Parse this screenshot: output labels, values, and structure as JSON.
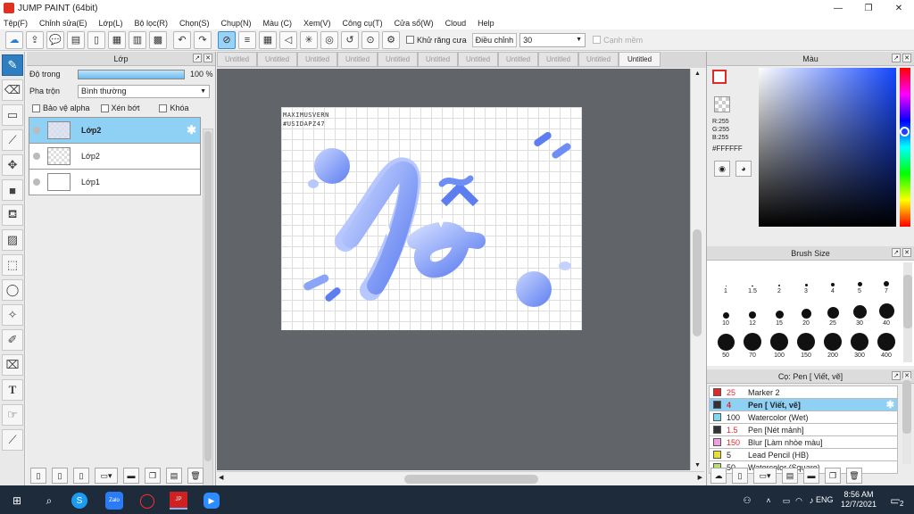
{
  "window": {
    "title": "JUMP PAINT (64bit)"
  },
  "menu": [
    "Tệp(F)",
    "Chỉnh sửa(E)",
    "Lớp(L)",
    "Bộ lọc(R)",
    "Chọn(S)",
    "Chụp(N)",
    "Màu (C)",
    "Xem(V)",
    "Công cụ(T)",
    "Cửa sổ(W)",
    "Cloud",
    "Help"
  ],
  "toolbar": {
    "antialias_label": "Khử răng cưa",
    "adjust_label": "Điều chỉnh",
    "adjust_value": "30",
    "snap_label": "Cạnh mềm"
  },
  "layer_panel": {
    "title": "Lớp",
    "opacity_label": "Độ trong",
    "opacity_value": "100 %",
    "opacity_fraction": 1.0,
    "blend_label": "Pha trộn",
    "blend_value": "Bình thường",
    "protect_alpha": "Bảo vệ alpha",
    "clip": "Xén bớt",
    "lock": "Khóa",
    "layers": [
      {
        "name": "Lớp2",
        "selected": true
      },
      {
        "name": "Lớp2",
        "selected": false
      },
      {
        "name": "Lớp1",
        "selected": false
      }
    ]
  },
  "tabs": [
    "Untitled",
    "Untitled",
    "Untitled",
    "Untitled",
    "Untitled",
    "Untitled",
    "Untitled",
    "Untitled",
    "Untitled",
    "Untitled",
    "Untitled"
  ],
  "artwork": {
    "signature_line1": "MAXIMUSVERN",
    "signature_line2": "#USIDAPZ47",
    "word": "Vẽ",
    "accent": "#6e8ef5"
  },
  "color_panel": {
    "title": "Màu",
    "r": "R:255",
    "g": "G:255",
    "b": "B:255",
    "hex": "#FFFFFF"
  },
  "brush_size": {
    "title": "Brush Size",
    "sizes": [
      "1",
      "1.5",
      "2",
      "3",
      "4",
      "5",
      "7",
      "10",
      "12",
      "15",
      "20",
      "25",
      "30",
      "40",
      "50",
      "70",
      "100",
      "150",
      "200",
      "300",
      "400"
    ]
  },
  "brush_list": {
    "title": "Cọ: Pen [ Viết, vẽ]",
    "items": [
      {
        "size": "25",
        "name": "Marker 2",
        "color": "#e02a2a",
        "selected": false,
        "size_color": "#e02a2a"
      },
      {
        "size": "4",
        "name": "Pen [ Viết, vẽ]",
        "color": "#333333",
        "selected": true,
        "size_color": "#e02a2a"
      },
      {
        "size": "100",
        "name": "Watercolor (Wet)",
        "color": "#7fd8f0",
        "selected": false,
        "size_color": "#222222"
      },
      {
        "size": "1.5",
        "name": "Pen [Nét mảnh]",
        "color": "#333333",
        "selected": false,
        "size_color": "#e02a2a"
      },
      {
        "size": "150",
        "name": "Blur [Làm nhòe màu]",
        "color": "#f0a0e0",
        "selected": false,
        "size_color": "#e02a2a"
      },
      {
        "size": "5",
        "name": "Lead Pencil (HB)",
        "color": "#e8e030",
        "selected": false,
        "size_color": "#222222"
      },
      {
        "size": "50",
        "name": "Watercolor (Square)",
        "color": "#b8e070",
        "selected": false,
        "size_color": "#222222"
      }
    ]
  },
  "taskbar": {
    "lang": "ENG",
    "time": "8:56 AM",
    "date": "12/7/2021",
    "notifications": "2"
  }
}
